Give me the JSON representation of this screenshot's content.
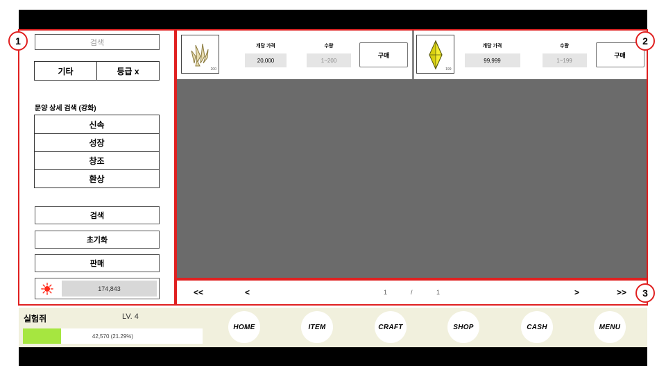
{
  "sidebar": {
    "search_placeholder": "검색",
    "filters": [
      "기타",
      "등급 x"
    ],
    "section_title": "문양 상세 검색 (강화)",
    "enhance_options": [
      "신속",
      "성장",
      "창조",
      "환상"
    ],
    "actions": {
      "search": "검색",
      "reset": "초기화",
      "sell": "판매"
    },
    "currency_value": "174,843",
    "currency_icon": "sun-icon",
    "currency_icon_color": "#ff2a1a"
  },
  "listings": [
    {
      "icon": "crystal-cluster-icon",
      "count": "200",
      "price_label": "개당 가격",
      "price": "20,000",
      "qty_label": "수량",
      "qty_range": "1~200",
      "buy_label": "구매"
    },
    {
      "icon": "yellow-gem-icon",
      "count": "199",
      "price_label": "개당 가격",
      "price": "99,999",
      "qty_label": "수량",
      "qty_range": "1~199",
      "buy_label": "구매"
    }
  ],
  "pagination": {
    "first": "<<",
    "prev": "<",
    "current": "1",
    "separator": "/",
    "total": "1",
    "next": ">",
    "last": ">>"
  },
  "player": {
    "name": "실험쥐",
    "level": "LV. 4",
    "exp_text": "42,570 (21.29%)",
    "exp_fraction": 0.2129,
    "exp_color": "#a6e640"
  },
  "nav": [
    "HOME",
    "ITEM",
    "CRAFT",
    "SHOP",
    "CASH",
    "MENU"
  ],
  "markers": [
    "1",
    "2",
    "3"
  ],
  "colors": {
    "highlight": "#e02020",
    "hud_bg": "#f1f0dd",
    "main_bg": "#6b6b6b"
  }
}
